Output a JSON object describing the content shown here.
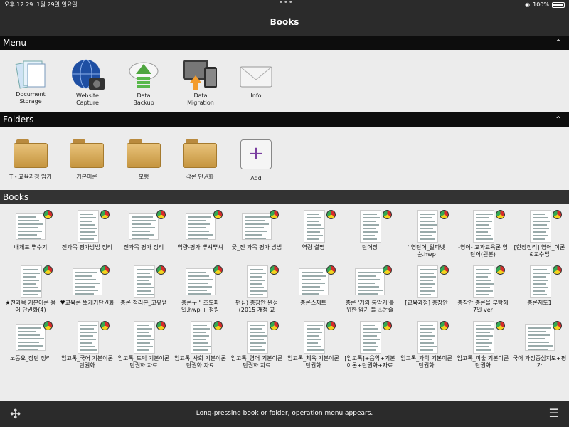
{
  "status": {
    "time": "오후 12:29",
    "date": "1월 29일 일요일",
    "battery": "100%"
  },
  "nav": {
    "title": "Books"
  },
  "sections": {
    "menu": "Menu",
    "folders": "Folders",
    "books": "Books"
  },
  "menu": [
    {
      "label": "Document\nStorage",
      "icon": "documents-icon"
    },
    {
      "label": "Website\nCapture",
      "icon": "globe-camera-icon"
    },
    {
      "label": "Data\nBackup",
      "icon": "cloud-upload-icon"
    },
    {
      "label": "Data\nMigration",
      "icon": "devices-migration-icon"
    },
    {
      "label": "Info",
      "icon": "envelope-icon"
    }
  ],
  "folders": [
    {
      "label": "T - 교육과정 암기"
    },
    {
      "label": "기본이론"
    },
    {
      "label": "모형"
    },
    {
      "label": "각론 단권화"
    },
    {
      "label": "Add"
    }
  ],
  "books": [
    {
      "label": "내체표 뿌수기",
      "tall": false
    },
    {
      "label": "전과목 평가방법 정리",
      "tall": true
    },
    {
      "label": "전과목 평가 정리",
      "tall": false
    },
    {
      "label": "역량-평가 뿌셔뿌셔",
      "tall": false
    },
    {
      "label": "뮻_전 과목 평가 방법",
      "tall": false
    },
    {
      "label": "역량 설명",
      "tall": true
    },
    {
      "label": "단어장",
      "tall": true
    },
    {
      "label": "' 영단어_알파벳순.hwp",
      "tall": true
    },
    {
      "label": "-영어- 교과교육론 영단어(원본)",
      "tall": true
    },
    {
      "label": "[한장정리] 영어_이론&교수법",
      "tall": true
    },
    {
      "label": "★전과목 기본이론 용어 단권화(4)",
      "tall": true
    },
    {
      "label": "♥교육론 뽀개기단권화",
      "tall": false
    },
    {
      "label": "총론 정리본_고유쌤",
      "tall": true
    },
    {
      "label": "총론구 \" 조도파일.hwp + 청킹",
      "tall": false
    },
    {
      "label": "편집) 총창안 완성 (2015 개정 교",
      "tall": true
    },
    {
      "label": "총론스제트",
      "tall": false
    },
    {
      "label": "총론 '거의 통암기'를 위한 암기 틀 ♨논술",
      "tall": false
    },
    {
      "label": "[교육과정] 총창안",
      "tall": true
    },
    {
      "label": "총창안 총론을 부탁해 7일 ver",
      "tall": true
    },
    {
      "label": "총론지도1",
      "tall": true
    },
    {
      "label": "노동요_장단 정리",
      "tall": false
    },
    {
      "label": "임고톡_국어 기본이론 단권화",
      "tall": true
    },
    {
      "label": "임고톡_도덕 기본이론 단권화 자료",
      "tall": true
    },
    {
      "label": "임고톡_사회 기본이론 단권화 자료",
      "tall": true
    },
    {
      "label": "임고톡_영어 기본이론 단권화 자료",
      "tall": true
    },
    {
      "label": "임고톡_체육 기본이론 단권화",
      "tall": true
    },
    {
      "label": "[임고톡]+음악+기본이론+단권화+자료",
      "tall": true
    },
    {
      "label": "임고톡_과학 기본이론 단권화",
      "tall": true
    },
    {
      "label": "임고톡_미술 기본이론 단권화",
      "tall": true
    },
    {
      "label": "국어 과정중심지도+평가",
      "tall": false
    }
  ],
  "bottom": {
    "message": "Long-pressing book or folder, operation menu appears."
  }
}
